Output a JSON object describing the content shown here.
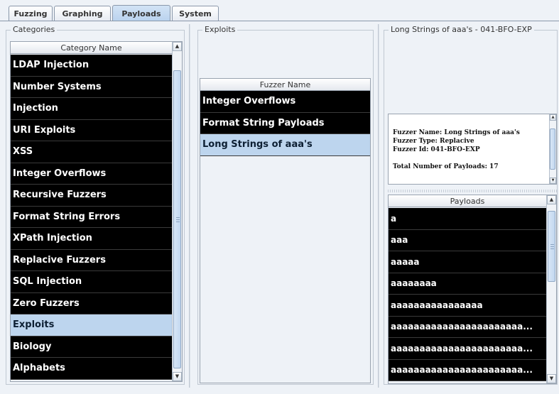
{
  "tabs": [
    {
      "label": "Fuzzing"
    },
    {
      "label": "Graphing"
    },
    {
      "label": "Payloads"
    },
    {
      "label": "System"
    }
  ],
  "active_tab": "Payloads",
  "categories": {
    "title": "Categories",
    "column": "Category Name",
    "items": [
      "LDAP Injection",
      "Number Systems",
      "Injection",
      "URI Exploits",
      "XSS",
      "Integer Overflows",
      "Recursive Fuzzers",
      "Format String Errors",
      "XPath Injection",
      "Replacive Fuzzers",
      "SQL Injection",
      "Zero Fuzzers",
      "Exploits",
      "Biology",
      "Alphabets"
    ],
    "selected": "Exploits"
  },
  "exploits": {
    "title": "Exploits",
    "column": "Fuzzer Name",
    "items": [
      "Integer Overflows",
      "Format String Payloads",
      "Long Strings of aaa's"
    ],
    "selected": "Long Strings of aaa's"
  },
  "detail": {
    "title": "Long Strings of aaa's - 041-BFO-EXP",
    "info": {
      "name_line": "Fuzzer Name: Long Strings of aaa's",
      "type_line": "Fuzzer Type: Replacive",
      "id_line": "Fuzzer Id:  041-BFO-EXP",
      "total_line": "Total Number of Payloads: 17"
    }
  },
  "payloads": {
    "column": "Payloads",
    "items": [
      "a",
      "aaa",
      "aaaaa",
      "aaaaaaaa",
      "aaaaaaaaaaaaaaaa",
      "aaaaaaaaaaaaaaaaaaaaaaa...",
      "aaaaaaaaaaaaaaaaaaaaaaa...",
      "aaaaaaaaaaaaaaaaaaaaaaa..."
    ]
  },
  "colors": {
    "row_bg": "#000000",
    "row_text": "#ffffff",
    "selected_bg": "#bdd5ee",
    "panel_bg": "#eef2f7"
  }
}
